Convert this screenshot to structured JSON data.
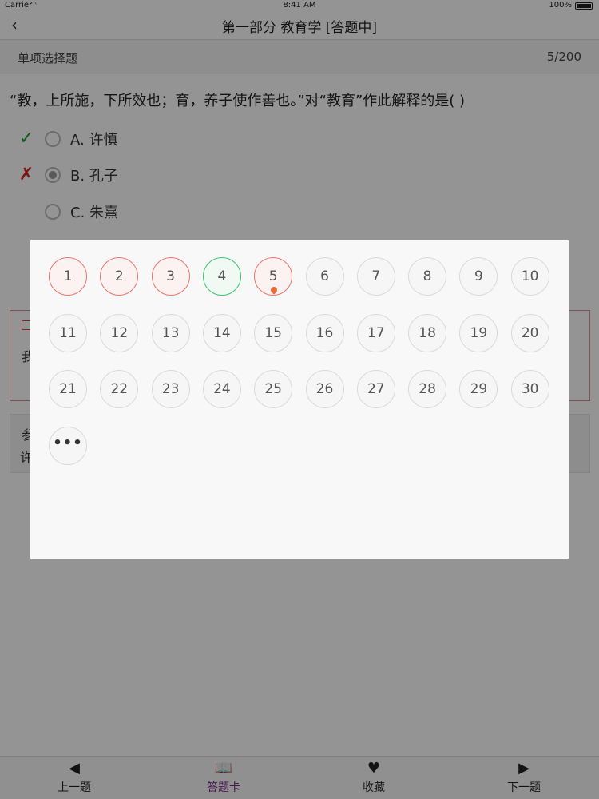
{
  "status_bar": {
    "carrier": "Carrier",
    "time": "8:41 AM",
    "battery": "100%"
  },
  "nav": {
    "title": "第一部分 教育学 [答题中]"
  },
  "question_header": {
    "type": "单项选择题",
    "progress": "5/200"
  },
  "question": {
    "text": "“教，上所施，下所效也；育，养子使作善也。”对“教育”作此解释的是(    )",
    "options": [
      {
        "label": "A. 许慎",
        "mark": "✓",
        "mark_type": "correct",
        "selected": false
      },
      {
        "label": "B. 孔子",
        "mark": "✗",
        "mark_type": "wrong",
        "selected": true
      },
      {
        "label": "C. 朱熹",
        "mark": "",
        "mark_type": "none",
        "selected": false
      }
    ]
  },
  "analysis": {
    "text": "我"
  },
  "reference": {
    "title": "参",
    "text": "许"
  },
  "answer_card": {
    "items": [
      {
        "n": "1",
        "state": "wrong"
      },
      {
        "n": "2",
        "state": "wrong"
      },
      {
        "n": "3",
        "state": "wrong"
      },
      {
        "n": "4",
        "state": "right"
      },
      {
        "n": "5",
        "state": "current"
      },
      {
        "n": "6",
        "state": "blank"
      },
      {
        "n": "7",
        "state": "blank"
      },
      {
        "n": "8",
        "state": "blank"
      },
      {
        "n": "9",
        "state": "blank"
      },
      {
        "n": "10",
        "state": "blank"
      },
      {
        "n": "11",
        "state": "blank"
      },
      {
        "n": "12",
        "state": "blank"
      },
      {
        "n": "13",
        "state": "blank"
      },
      {
        "n": "14",
        "state": "blank"
      },
      {
        "n": "15",
        "state": "blank"
      },
      {
        "n": "16",
        "state": "blank"
      },
      {
        "n": "17",
        "state": "blank"
      },
      {
        "n": "18",
        "state": "blank"
      },
      {
        "n": "19",
        "state": "blank"
      },
      {
        "n": "20",
        "state": "blank"
      },
      {
        "n": "21",
        "state": "blank"
      },
      {
        "n": "22",
        "state": "blank"
      },
      {
        "n": "23",
        "state": "blank"
      },
      {
        "n": "24",
        "state": "blank"
      },
      {
        "n": "25",
        "state": "blank"
      },
      {
        "n": "26",
        "state": "blank"
      },
      {
        "n": "27",
        "state": "blank"
      },
      {
        "n": "28",
        "state": "blank"
      },
      {
        "n": "29",
        "state": "blank"
      },
      {
        "n": "30",
        "state": "blank"
      }
    ],
    "more_label": "•••"
  },
  "tabs": [
    {
      "label": "上一题",
      "icon": "arrow-left-icon",
      "glyph": "◀",
      "active": false
    },
    {
      "label": "答题卡",
      "icon": "book-icon",
      "glyph": "📖",
      "active": true
    },
    {
      "label": "收藏",
      "icon": "heart-icon",
      "glyph": "♥",
      "active": false
    },
    {
      "label": "下一题",
      "icon": "arrow-right-icon",
      "glyph": "▶",
      "active": false
    }
  ],
  "colors": {
    "wrong": "#e7776c",
    "right": "#3cc46c",
    "active_tab": "#7b2a8a"
  }
}
